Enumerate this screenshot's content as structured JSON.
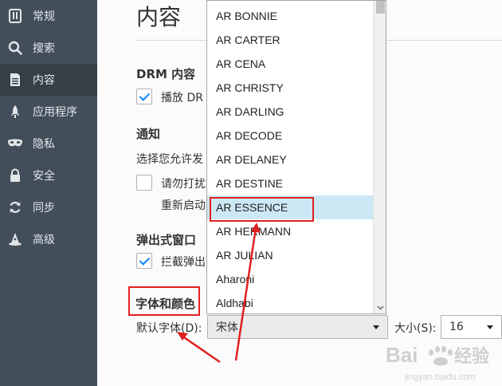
{
  "sidebar": {
    "items": [
      {
        "label": "常规",
        "icon": "general-icon"
      },
      {
        "label": "搜索",
        "icon": "search-icon"
      },
      {
        "label": "内容",
        "icon": "content-icon",
        "active": true
      },
      {
        "label": "应用程序",
        "icon": "rocket-icon"
      },
      {
        "label": "隐私",
        "icon": "mask-icon"
      },
      {
        "label": "安全",
        "icon": "lock-icon"
      },
      {
        "label": "同步",
        "icon": "sync-icon"
      },
      {
        "label": "高级",
        "icon": "wizard-hat-icon"
      }
    ]
  },
  "main": {
    "title": "内容",
    "drm": {
      "heading": "DRM 内容",
      "checkbox_label": "播放 DR",
      "checked": true
    },
    "notifications": {
      "heading": "通知",
      "text": "选择您允许发",
      "dnd_label": "请勿打扰",
      "restart_text": "重新启动",
      "checked": false
    },
    "popups": {
      "heading": "弹出式窗口",
      "checkbox_label": "拦截弹出",
      "checked": true
    },
    "fonts": {
      "heading": "字体和颜色",
      "default_font_label": "默认字体(D):",
      "default_font_value": "宋体",
      "size_label": "大小(S):",
      "size_value": "16"
    }
  },
  "font_dropdown": {
    "options": [
      "AR BONNIE",
      "AR CARTER",
      "AR CENA",
      "AR CHRISTY",
      "AR DARLING",
      "AR DECODE",
      "AR DELANEY",
      "AR DESTINE",
      "AR ESSENCE",
      "AR HERMANN",
      "AR JULIAN",
      "Aharoni",
      "Aldhabi"
    ],
    "selected": "AR ESSENCE"
  },
  "watermark": {
    "brand": "Baidu",
    "sub": "经验",
    "url": "jingyan.baidu.com"
  },
  "colors": {
    "sidebar": "#424f5a",
    "sidebar_active": "#343f48",
    "highlight": "#cce8f5",
    "annotation": "#e02020",
    "check": "#0a84ff"
  }
}
